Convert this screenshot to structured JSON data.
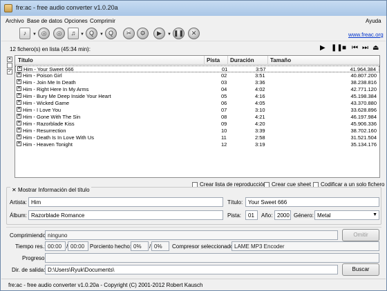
{
  "window": {
    "title": "fre:ac - free audio converter v1.0.20a",
    "help": "Ayuda"
  },
  "menu": [
    "Archivo",
    "Base de datos",
    "Opciones",
    "Comprimir"
  ],
  "toolbar": {
    "website_link": "www.freac.org"
  },
  "list": {
    "count_label": "12 fichero(s) en lista (45:34 min):",
    "columns": [
      "Título",
      "Pista",
      "Duración",
      "Tamaño"
    ],
    "rows": [
      {
        "title": "Him - Your Sweet 666",
        "track": "01",
        "duration": "3:57",
        "size": "41.964.384"
      },
      {
        "title": "Him - Poison Girl",
        "track": "02",
        "duration": "3:51",
        "size": "40.807.200"
      },
      {
        "title": "Him - Join Me In Death",
        "track": "03",
        "duration": "3:36",
        "size": "38.238.816"
      },
      {
        "title": "Him - Right Here In My Arms",
        "track": "04",
        "duration": "4:02",
        "size": "42.771.120"
      },
      {
        "title": "Him - Bury Me Deep Inside Your Heart",
        "track": "05",
        "duration": "4:16",
        "size": "45.198.384"
      },
      {
        "title": "Him - Wicked Game",
        "track": "06",
        "duration": "4:05",
        "size": "43.370.880"
      },
      {
        "title": "Him - I Love You",
        "track": "07",
        "duration": "3:10",
        "size": "33.628.896"
      },
      {
        "title": "Him - Gone With The Sin",
        "track": "08",
        "duration": "4:21",
        "size": "46.197.984"
      },
      {
        "title": "Him - Razorblade Kiss",
        "track": "09",
        "duration": "4:20",
        "size": "45.906.336"
      },
      {
        "title": "Him - Resurrection",
        "track": "10",
        "duration": "3:39",
        "size": "38.702.160"
      },
      {
        "title": "Him - Death Is In Love With Us",
        "track": "11",
        "duration": "2:58",
        "size": "31.521.504"
      },
      {
        "title": "Him - Heaven Tonight",
        "track": "12",
        "duration": "3:19",
        "size": "35.134.176"
      }
    ]
  },
  "options": {
    "playlist": "Crear lista de reproducción",
    "cuesheet": "Crear cue sheet",
    "single_file": "Codificar a un solo fichero"
  },
  "title_info": {
    "toggle": "Mostrar Información del título",
    "artist_label": "Artista:",
    "artist": "Him",
    "title_label": "Título:",
    "title": "Your Sweet 666",
    "album_label": "Álbum:",
    "album": "Razorblade Romance",
    "track_label": "Pista:",
    "track": "01",
    "year_label": "Año:",
    "year": "2000",
    "genre_label": "Género:",
    "genre": "Metal"
  },
  "encoder": {
    "compressing_label": "Comprimiendo:",
    "compressing": "ninguno",
    "skip_button": "Omitir",
    "time_label": "Tiempo res.:",
    "time_left": "00:00",
    "time_total": "00:00",
    "percent_label": "Porciento hecho:",
    "percent": "0%",
    "percent_total": "0%",
    "encoder_label": "Compresor seleccionado:",
    "encoder": "LAME MP3 Encoder",
    "progress_label": "Progreso:",
    "outdir_label": "Dir. de salida:",
    "outdir": "D:\\Users\\Ryuk\\Documents\\",
    "browse_button": "Buscar"
  },
  "status": "fre:ac - free audio converter v1.0.20a - Copyright (C) 2001-2012 Robert Kausch"
}
